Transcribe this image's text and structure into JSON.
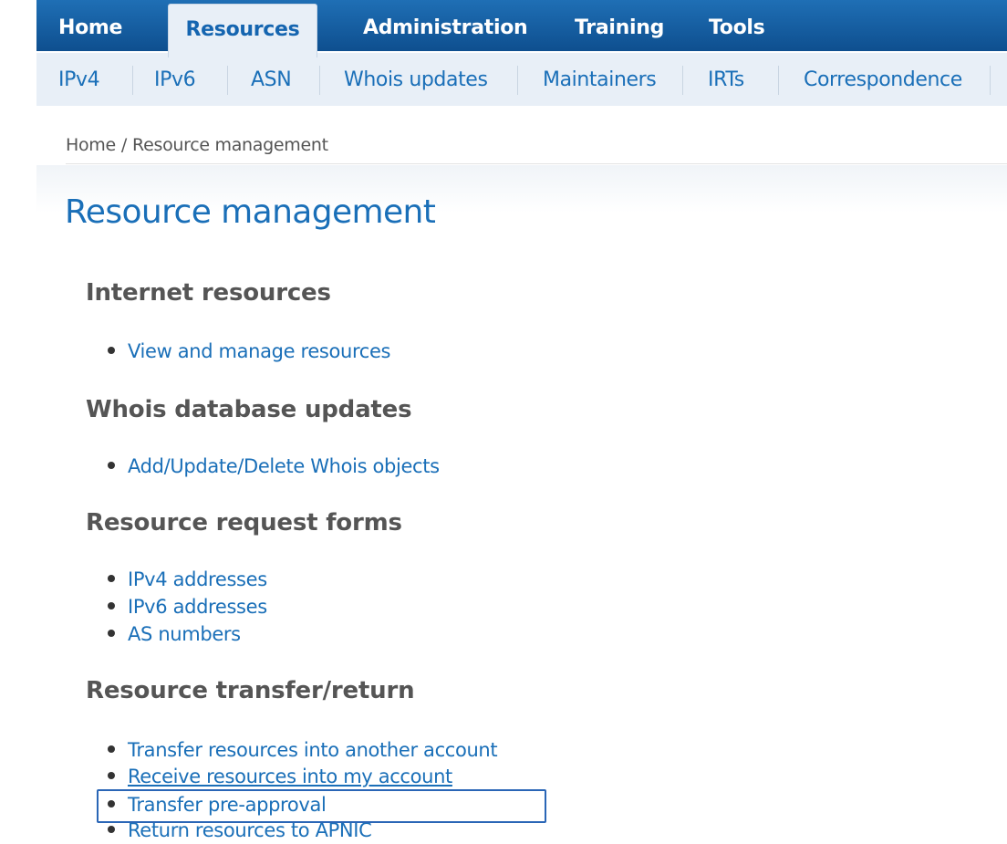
{
  "topnav": {
    "tabs": [
      {
        "label": "Home"
      },
      {
        "label": "Resources"
      },
      {
        "label": "Administration"
      },
      {
        "label": "Training"
      },
      {
        "label": "Tools"
      }
    ],
    "active_tab": "Resources"
  },
  "subnav": {
    "items": [
      {
        "label": "IPv4"
      },
      {
        "label": "IPv6"
      },
      {
        "label": "ASN"
      },
      {
        "label": "Whois updates"
      },
      {
        "label": "Maintainers"
      },
      {
        "label": "IRTs"
      },
      {
        "label": "Correspondence"
      }
    ]
  },
  "breadcrumb": {
    "home": "Home",
    "separator": "/",
    "current": "Resource management"
  },
  "page": {
    "title": "Resource management"
  },
  "sections": {
    "internet_resources": {
      "heading": "Internet resources",
      "links": [
        "View and manage resources"
      ]
    },
    "whois_updates": {
      "heading": "Whois database updates",
      "links": [
        "Add/Update/Delete Whois objects"
      ]
    },
    "request_forms": {
      "heading": "Resource request forms",
      "links": [
        "IPv4 addresses",
        "IPv6 addresses",
        "AS numbers"
      ]
    },
    "transfer_return": {
      "heading": "Resource transfer/return",
      "links": [
        "Transfer resources into another account",
        "Receive resources into my account",
        "Transfer pre-approval",
        "Return resources to APNIC"
      ]
    }
  },
  "colors": {
    "nav_bar": "#0e4f8f",
    "link": "#1a6fb8",
    "heading": "#555555",
    "highlight_border": "#2a66b6"
  },
  "icons": [
    "bullet-icon"
  ]
}
